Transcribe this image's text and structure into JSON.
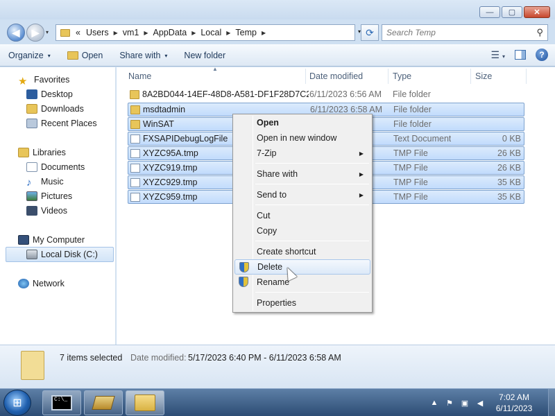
{
  "window": {
    "buttons": {
      "minimize": "—",
      "maximize": "▢",
      "close": "✕"
    }
  },
  "nav": {
    "back": "◀",
    "forward": "▶",
    "history": "▾",
    "breadcrumb": [
      "«",
      "Users",
      "vm1",
      "AppData",
      "Local",
      "Temp"
    ],
    "address_dropdown": "▾",
    "refresh": "⟳",
    "search_placeholder": "Search Temp",
    "search_icon": "⚲"
  },
  "toolbar": {
    "organize": "Organize",
    "open": "Open",
    "share_with": "Share with",
    "new_folder": "New folder",
    "caret": "▾"
  },
  "sidebar": {
    "favorites": "Favorites",
    "desktop": "Desktop",
    "downloads": "Downloads",
    "recent_places": "Recent Places",
    "libraries": "Libraries",
    "documents": "Documents",
    "music": "Music",
    "pictures": "Pictures",
    "videos": "Videos",
    "my_computer": "My Computer",
    "local_disk": "Local Disk (C:)",
    "network": "Network"
  },
  "columns": {
    "name": "Name",
    "date": "Date modified",
    "type": "Type",
    "size": "Size"
  },
  "files": [
    {
      "name": "8A2BD044-14EF-48D8-A581-DF1F28D7C2...",
      "date": "6/11/2023 6:56 AM",
      "type": "File folder",
      "size": "",
      "kind": "folder",
      "selected": false
    },
    {
      "name": "msdtadmin",
      "date": "6/11/2023 6:58 AM",
      "type": "File folder",
      "size": "",
      "kind": "folder",
      "selected": true
    },
    {
      "name": "WinSAT",
      "date": "",
      "type": "File folder",
      "size": "",
      "kind": "folder",
      "selected": true
    },
    {
      "name": "FXSAPIDebugLogFile",
      "date": "",
      "type": "Text Document",
      "size": "0 KB",
      "kind": "file",
      "selected": true
    },
    {
      "name": "XYZC95A.tmp",
      "date": "",
      "type": "TMP File",
      "size": "26 KB",
      "kind": "file",
      "selected": true
    },
    {
      "name": "XYZC919.tmp",
      "date": "",
      "type": "TMP File",
      "size": "26 KB",
      "kind": "file",
      "selected": true
    },
    {
      "name": "XYZC929.tmp",
      "date": "",
      "type": "TMP File",
      "size": "35 KB",
      "kind": "file",
      "selected": true
    },
    {
      "name": "XYZC959.tmp",
      "date": "",
      "type": "TMP File",
      "size": "35 KB",
      "kind": "file",
      "selected": true
    }
  ],
  "status": {
    "count": "7 items selected",
    "date_label": "Date modified:",
    "date_value": "5/17/2023 6:40 PM - 6/11/2023 6:58 AM"
  },
  "context_menu": {
    "open": "Open",
    "open_new_window": "Open in new window",
    "seven_zip": "7-Zip",
    "share_with": "Share with",
    "send_to": "Send to",
    "cut": "Cut",
    "copy": "Copy",
    "create_shortcut": "Create shortcut",
    "delete": "Delete",
    "rename": "Rename",
    "properties": "Properties",
    "submenu_arrow": "▶"
  },
  "taskbar": {
    "start": "⊞",
    "cmd_text": "C:\\_",
    "time": "7:02 AM",
    "date": "6/11/2023",
    "tray_chevron": "▲"
  }
}
